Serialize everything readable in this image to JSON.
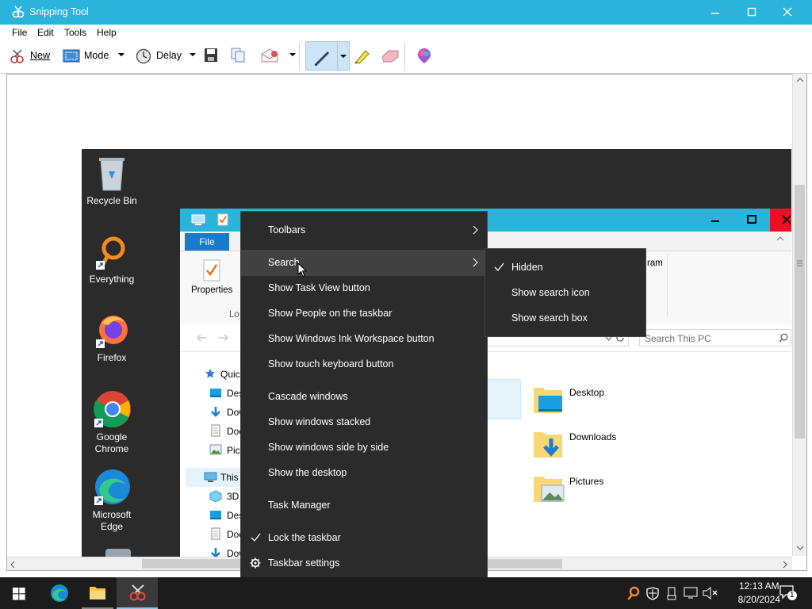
{
  "app": {
    "title": "Snipping Tool"
  },
  "menu": [
    "File",
    "Edit",
    "Tools",
    "Help"
  ],
  "toolbar": {
    "new_label": "New",
    "mode_label": "Mode",
    "delay_label": "Delay"
  },
  "desktop_icons": [
    {
      "label": "Recycle Bin"
    },
    {
      "label": "Everything"
    },
    {
      "label": "Firefox"
    },
    {
      "label": "Google Chrome"
    },
    {
      "label": "Microsoft Edge"
    }
  ],
  "explorer": {
    "file_tab": "File",
    "properties_label": "Properties",
    "location_partial": "Lo",
    "program_partial": "ram",
    "search_placeholder": "Search This PC",
    "nav": [
      "Quic",
      "Des",
      "Dow",
      "Doc",
      "Pict",
      "This",
      "3D",
      "Des",
      "Doc",
      "Dow"
    ],
    "folders": [
      "Desktop",
      "Downloads",
      "Pictures"
    ]
  },
  "context_menu": {
    "items": [
      {
        "label": "Toolbars",
        "submenu": true
      },
      {
        "label": "Search",
        "submenu": true,
        "highlighted": true
      },
      {
        "label": "Show Task View button"
      },
      {
        "label": "Show People on the taskbar"
      },
      {
        "label": "Show Windows Ink Workspace button"
      },
      {
        "label": "Show touch keyboard button"
      },
      {
        "label": "Cascade windows"
      },
      {
        "label": "Show windows stacked"
      },
      {
        "label": "Show windows side by side"
      },
      {
        "label": "Show the desktop"
      },
      {
        "label": "Task Manager"
      },
      {
        "label": "Lock the taskbar",
        "checked": true
      },
      {
        "label": "Taskbar settings",
        "icon": "gear-icon"
      }
    ]
  },
  "search_submenu": {
    "items": [
      {
        "label": "Hidden",
        "checked": true
      },
      {
        "label": "Show search icon"
      },
      {
        "label": "Show search box"
      }
    ]
  },
  "taskbar": {
    "time": "12:13 AM",
    "date": "8/20/2024",
    "notification_count": "1"
  },
  "colors": {
    "accent": "#2cb3dc",
    "menu_bg": "#2b2b2b",
    "taskbar_bg": "#1c1c1c"
  }
}
